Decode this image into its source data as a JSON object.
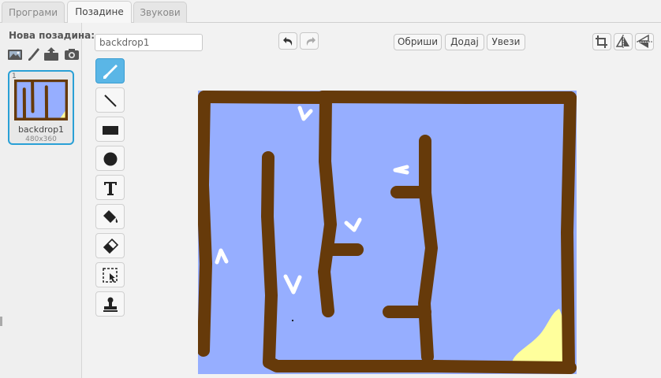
{
  "tabs": [
    {
      "label": "Програми",
      "active": false
    },
    {
      "label": "Позадине",
      "active": true
    },
    {
      "label": "Звукови",
      "active": false
    }
  ],
  "sidebar": {
    "title": "Нова позадина:",
    "new_icons": [
      "image-icon",
      "paintbrush-icon",
      "upload-icon",
      "camera-icon"
    ],
    "backdrop": {
      "index": "1",
      "name": "backdrop1",
      "size": "480x360"
    }
  },
  "editor": {
    "name_value": "backdrop1",
    "undo_icon": "undo-icon",
    "redo_icon": "redo-icon",
    "clear_label": "Обриши",
    "add_label": "Додај",
    "import_label": "Увези",
    "right_tools": [
      "crop-icon",
      "flip-horizontal-icon",
      "flip-vertical-icon"
    ],
    "tools": [
      "brush-icon",
      "line-icon",
      "rectangle-icon",
      "ellipse-icon",
      "text-icon",
      "fill-icon",
      "eraser-icon",
      "select-icon",
      "stamp-icon"
    ],
    "active_tool": "brush-icon"
  },
  "colors": {
    "accent": "#2aa0d6",
    "canvas_bg": "#96aeff",
    "wall": "#663a0a",
    "goal": "#ffff9c"
  }
}
